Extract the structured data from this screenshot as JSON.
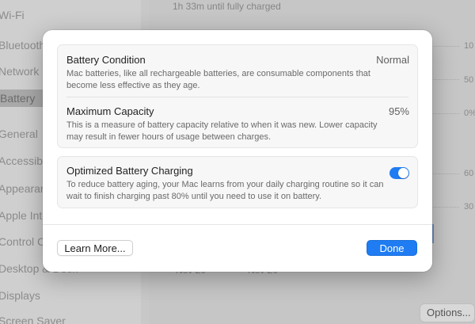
{
  "background": {
    "sidebar_items": [
      {
        "label": "Wi-Fi",
        "selected": false
      },
      {
        "label": "Bluetooth",
        "selected": false
      },
      {
        "label": "Network",
        "selected": false
      },
      {
        "label": "Battery",
        "selected": true
      },
      {
        "label": "General",
        "selected": false
      },
      {
        "label": "Accessibility",
        "selected": false
      },
      {
        "label": "Appearance",
        "selected": false
      },
      {
        "label": "Apple Intelligence",
        "selected": false
      },
      {
        "label": "Control Centre",
        "selected": false
      },
      {
        "label": "Desktop & Dock",
        "selected": false
      },
      {
        "label": "Displays",
        "selected": false
      },
      {
        "label": "Screen Saver",
        "selected": false
      }
    ],
    "status": "1h 33m until fully charged",
    "chart_ticks": [
      "10",
      "50",
      "0%",
      "60",
      "30"
    ],
    "x_labels": [
      "Nov 20",
      "Nov 20"
    ],
    "options_label": "Options..."
  },
  "dialog": {
    "battery_condition": {
      "title": "Battery Condition",
      "value": "Normal",
      "description": "Mac batteries, like all rechargeable batteries, are consumable components that become less effective as they age."
    },
    "maximum_capacity": {
      "title": "Maximum Capacity",
      "value": "95%",
      "description": "This is a measure of battery capacity relative to when it was new. Lower capacity may result in fewer hours of usage between charges."
    },
    "optimized_charging": {
      "title": "Optimized Battery Charging",
      "enabled": true,
      "description": "To reduce battery aging, your Mac learns from your daily charging routine so it can wait to finish charging past 80% until you need to use it on battery."
    },
    "learn_more_label": "Learn More...",
    "done_label": "Done"
  },
  "colors": {
    "accent": "#1f7cf2",
    "toggle_on": "#1f7cf2"
  }
}
